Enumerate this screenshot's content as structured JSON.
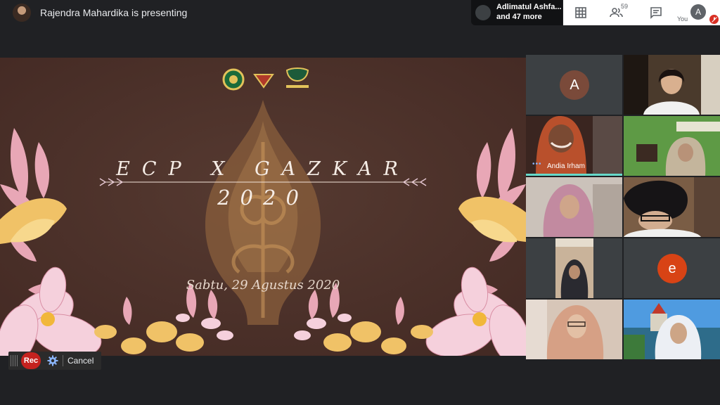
{
  "meeting": {
    "presenting_text": "Rajendra Mahardika is presenting",
    "speaker_chip": {
      "line1": "Adlimatul Ashfa...",
      "line2": "and 47 more"
    },
    "participant_count": "59",
    "self": {
      "initial": "A",
      "label": "You"
    }
  },
  "slide": {
    "title": "ECP X GAZKAR",
    "year": "2020",
    "date": "Sabtu, 29 Agustus 2020"
  },
  "recording": {
    "rec_label": "Rec",
    "cancel_label": "Cancel"
  },
  "tiles": [
    {
      "kind": "avatar",
      "initial": "A",
      "avatar_color": "#7a4a3a"
    },
    {
      "kind": "video",
      "name": ""
    },
    {
      "kind": "video",
      "name": "Andia Irham",
      "speaking": true
    },
    {
      "kind": "video",
      "name": ""
    },
    {
      "kind": "video",
      "name": ""
    },
    {
      "kind": "video",
      "name": ""
    },
    {
      "kind": "video",
      "name": ""
    },
    {
      "kind": "avatar",
      "initial": "e",
      "avatar_color": "#d84315"
    },
    {
      "kind": "video",
      "name": ""
    },
    {
      "kind": "video",
      "name": ""
    }
  ],
  "icons": [
    "presenter-avatar",
    "grid-view-icon",
    "people-icon",
    "chat-icon",
    "mic-off-icon",
    "gear-icon"
  ]
}
